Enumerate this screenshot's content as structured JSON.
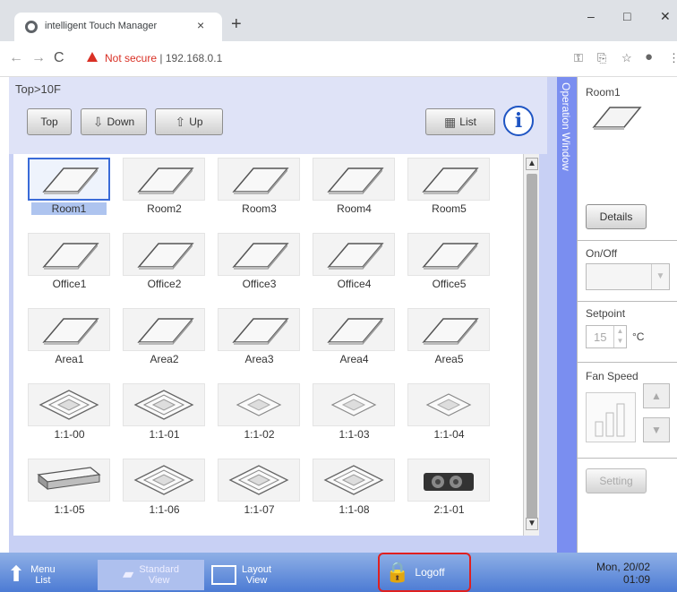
{
  "browser": {
    "tab_title": "intelligent Touch Manager",
    "tab_close": "×",
    "new_tab": "+",
    "win_min": "–",
    "win_max": "□",
    "win_close": "✕",
    "url_warning": "Not secure",
    "url_sep": "|",
    "url": "192.168.0.1"
  },
  "app": {
    "breadcrumb": "Top>10F",
    "toolbar": {
      "top": "Top",
      "down": "Down",
      "up": "Up",
      "list": "List",
      "info": "i"
    },
    "devices": [
      {
        "label": "Room1",
        "type": "flat",
        "selected": true
      },
      {
        "label": "Room2",
        "type": "flat"
      },
      {
        "label": "Room3",
        "type": "flat"
      },
      {
        "label": "Room4",
        "type": "flat"
      },
      {
        "label": "Room5",
        "type": "flat"
      },
      {
        "label": "Office1",
        "type": "flat"
      },
      {
        "label": "Office2",
        "type": "flat"
      },
      {
        "label": "Office3",
        "type": "flat"
      },
      {
        "label": "Office4",
        "type": "flat"
      },
      {
        "label": "Office5",
        "type": "flat"
      },
      {
        "label": "Area1",
        "type": "flat"
      },
      {
        "label": "Area2",
        "type": "flat"
      },
      {
        "label": "Area3",
        "type": "flat"
      },
      {
        "label": "Area4",
        "type": "flat"
      },
      {
        "label": "Area5",
        "type": "flat"
      },
      {
        "label": "1:1-00",
        "type": "cassette"
      },
      {
        "label": "1:1-01",
        "type": "cassette"
      },
      {
        "label": "1:1-02",
        "type": "cassette-small"
      },
      {
        "label": "1:1-03",
        "type": "cassette-small"
      },
      {
        "label": "1:1-04",
        "type": "cassette-small"
      },
      {
        "label": "1:1-05",
        "type": "ceiling"
      },
      {
        "label": "1:1-06",
        "type": "cassette"
      },
      {
        "label": "1:1-07",
        "type": "cassette"
      },
      {
        "label": "1:1-08",
        "type": "cassette"
      },
      {
        "label": "2:1-01",
        "type": "duct"
      }
    ],
    "operation_window": {
      "title": "Operation Window",
      "name": "Room1",
      "details": "Details",
      "onoff_label": "On/Off",
      "setpoint_label": "Setpoint",
      "setpoint_value": "15",
      "setpoint_unit": "°C",
      "fanspeed_label": "Fan Speed",
      "setting": "Setting"
    }
  },
  "taskbar": {
    "menu_list": [
      "Menu",
      "List"
    ],
    "standard_view": [
      "Standard",
      "View"
    ],
    "layout_view": [
      "Layout",
      "View"
    ],
    "logoff": "Logoff",
    "date": "Mon, 20/02",
    "time": "01:09"
  }
}
